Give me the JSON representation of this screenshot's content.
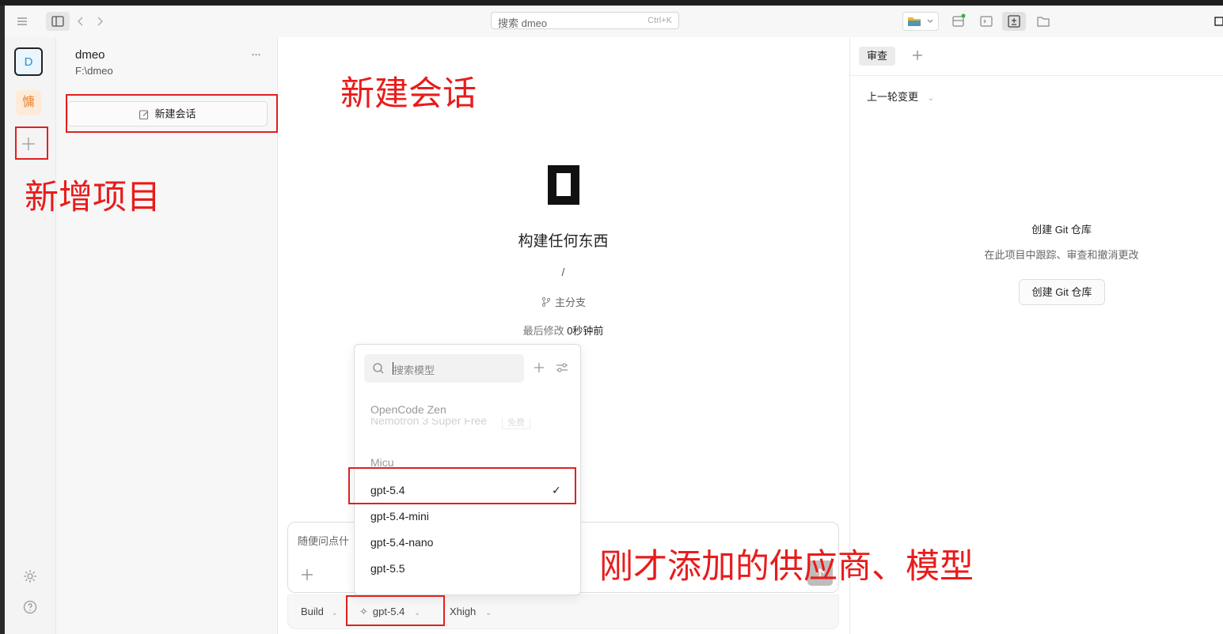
{
  "titlebar": {
    "search_placeholder": "搜索 dmeo",
    "search_shortcut": "Ctrl+K"
  },
  "rail": {
    "projects": [
      {
        "label": "D",
        "active": true
      },
      {
        "label": "慵",
        "active": false
      }
    ]
  },
  "sidebar": {
    "project_name": "dmeo",
    "project_path": "F:\\dmeo",
    "more_label": "···",
    "new_conversation_label": "新建会话"
  },
  "main": {
    "headline": "构建任何东西",
    "path": "/",
    "branch": "主分支",
    "last_modified_label": "最后修改",
    "last_modified_value": "0秒钟前",
    "composer_placeholder": "随便问点什"
  },
  "model_dropdown": {
    "search_placeholder": "搜索模型",
    "groups": [
      {
        "name": "OpenCode Zen",
        "models": [
          {
            "label": "Nemotron 3 Super Free",
            "badge": "免费",
            "faded": true
          }
        ]
      },
      {
        "name": "Micu",
        "models": [
          {
            "label": "gpt-5.4",
            "selected": true
          },
          {
            "label": "gpt-5.4-mini"
          },
          {
            "label": "gpt-5.4-nano"
          },
          {
            "label": "gpt-5.5"
          }
        ]
      }
    ],
    "check_mark": "✓"
  },
  "bottombar": {
    "agent": "Build",
    "model": "gpt-5.4",
    "effort": "Xhigh"
  },
  "right_panel": {
    "tab_review": "审查",
    "changes_dropdown": "上一轮变更",
    "empty_title": "创建 Git 仓库",
    "empty_desc": "在此项目中跟踪、审查和撤消更改",
    "create_git_button": "创建 Git 仓库"
  },
  "annotations": {
    "new_conversation": "新建会话",
    "add_project": "新增项目",
    "provider_model": "刚才添加的供应商、模型"
  },
  "colors": {
    "annotation_red": "#e81c1c",
    "project_d_accent": "#2a8fd6",
    "project_2_accent": "#e8883a"
  }
}
